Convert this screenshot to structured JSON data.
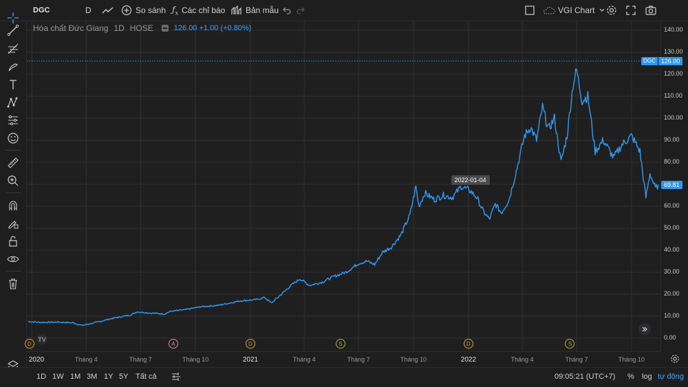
{
  "toolbar": {
    "symbol": "DGC",
    "interval": "D",
    "compare_label": "So sánh",
    "indicators_label": "Các chỉ báo",
    "templates_label": "Bản mẫu",
    "layout_name": "VGI Chart"
  },
  "legend": {
    "name": "Hóa chất Đức Giang",
    "interval": "1D",
    "exchange": "HOSE",
    "last": "126.00",
    "change": "+1.00",
    "change_pct": "(+0.80%)"
  },
  "price_scale": {
    "ticks": [
      "140.00",
      "130.00",
      "120.00",
      "110.00",
      "100.00",
      "90.00",
      "80.00",
      "70.00",
      "60.00",
      "50.00",
      "40.00",
      "30.00",
      "20.00",
      "10.00",
      "0.00"
    ],
    "dgc_tag_label": "DGC",
    "dgc_tag_value": "126.00",
    "last_price_tag": "69.81"
  },
  "time_scale": {
    "labels": [
      {
        "text": "2020",
        "year": true
      },
      {
        "text": "Tháng 4",
        "year": false
      },
      {
        "text": "Tháng 7",
        "year": false
      },
      {
        "text": "Tháng 10",
        "year": false
      },
      {
        "text": "2021",
        "year": true
      },
      {
        "text": "Tháng 4",
        "year": false
      },
      {
        "text": "Tháng 7",
        "year": false
      },
      {
        "text": "Tháng 10",
        "year": false
      },
      {
        "text": "2022",
        "year": true
      },
      {
        "text": "Tháng 4",
        "year": false
      },
      {
        "text": "Tháng 7",
        "year": false
      },
      {
        "text": "Tháng 10",
        "year": false
      }
    ]
  },
  "crosshair_date": "2022-01-04",
  "events": [
    {
      "letter": "D",
      "color": "#e0a020"
    },
    {
      "letter": "A",
      "color": "#e88aa0"
    },
    {
      "letter": "D",
      "color": "#e0a020"
    },
    {
      "letter": "S",
      "color": "#b0b020"
    },
    {
      "letter": "D",
      "color": "#e0a020"
    },
    {
      "letter": "S",
      "color": "#b0b020"
    }
  ],
  "bottom": {
    "ranges": [
      "1D",
      "1W",
      "1M",
      "3M",
      "1Y",
      "5Y",
      "Tất cả"
    ],
    "time": "09:05:21 (UTC+7)",
    "pct": "%",
    "log": "log",
    "auto": "tự động"
  },
  "colors": {
    "line": "#2f96ec",
    "accent": "#3ea6ff",
    "background": "#1f1f20",
    "grid": "#313133"
  },
  "chart_data": {
    "type": "line",
    "title": "",
    "ylabel": "",
    "xlabel": "",
    "ylim": [
      0,
      140
    ],
    "x_start": "2019-12-26",
    "x_end": "2022-11-15",
    "series": [
      {
        "values_by_date": [
          [
            "2019-12-26",
            7.6
          ],
          [
            "2020-01-15",
            7.2
          ],
          [
            "2020-02-15",
            7.3
          ],
          [
            "2020-03-10",
            7.0
          ],
          [
            "2020-03-25",
            5.8
          ],
          [
            "2020-04-15",
            7.0
          ],
          [
            "2020-05-15",
            9.0
          ],
          [
            "2020-06-15",
            10.6
          ],
          [
            "2020-06-25",
            12.0
          ],
          [
            "2020-07-15",
            11.5
          ],
          [
            "2020-08-10",
            11.0
          ],
          [
            "2020-08-20",
            12.2
          ],
          [
            "2020-09-15",
            13.0
          ],
          [
            "2020-10-10",
            14.3
          ],
          [
            "2020-11-10",
            15.0
          ],
          [
            "2020-12-15",
            17.0
          ],
          [
            "2021-01-10",
            17.5
          ],
          [
            "2021-01-25",
            18.5
          ],
          [
            "2021-02-05",
            16.0
          ],
          [
            "2021-02-20",
            19.5
          ],
          [
            "2021-03-10",
            24.0
          ],
          [
            "2021-03-25",
            27.0
          ],
          [
            "2021-04-10",
            24.0
          ],
          [
            "2021-05-01",
            25.5
          ],
          [
            "2021-05-20",
            28.0
          ],
          [
            "2021-06-10",
            30.0
          ],
          [
            "2021-07-01",
            34.0
          ],
          [
            "2021-07-15",
            35.0
          ],
          [
            "2021-07-28",
            33.5
          ],
          [
            "2021-08-10",
            39.0
          ],
          [
            "2021-08-25",
            41.5
          ],
          [
            "2021-09-10",
            47.0
          ],
          [
            "2021-09-25",
            56.0
          ],
          [
            "2021-10-05",
            69.0
          ],
          [
            "2021-10-10",
            60.0
          ],
          [
            "2021-10-20",
            66.0
          ],
          [
            "2021-11-05",
            63.0
          ],
          [
            "2021-11-20",
            65.0
          ],
          [
            "2021-12-05",
            64.0
          ],
          [
            "2021-12-20",
            69.0
          ],
          [
            "2022-01-04",
            67.0
          ],
          [
            "2022-01-15",
            64.0
          ],
          [
            "2022-01-25",
            58.0
          ],
          [
            "2022-02-05",
            54.0
          ],
          [
            "2022-02-15",
            61.0
          ],
          [
            "2022-02-25",
            57.0
          ],
          [
            "2022-03-10",
            63.0
          ],
          [
            "2022-03-22",
            76.0
          ],
          [
            "2022-04-05",
            92.0
          ],
          [
            "2022-04-15",
            96.0
          ],
          [
            "2022-04-25",
            90.0
          ],
          [
            "2022-05-05",
            105.0
          ],
          [
            "2022-05-15",
            95.0
          ],
          [
            "2022-05-25",
            100.0
          ],
          [
            "2022-06-05",
            80.0
          ],
          [
            "2022-06-15",
            92.0
          ],
          [
            "2022-06-25",
            115.0
          ],
          [
            "2022-07-01",
            122.0
          ],
          [
            "2022-07-10",
            108.0
          ],
          [
            "2022-07-20",
            110.0
          ],
          [
            "2022-08-01",
            85.0
          ],
          [
            "2022-08-15",
            90.0
          ],
          [
            "2022-09-01",
            82.0
          ],
          [
            "2022-09-15",
            88.0
          ],
          [
            "2022-10-01",
            92.0
          ],
          [
            "2022-10-15",
            85.0
          ],
          [
            "2022-10-25",
            64.0
          ],
          [
            "2022-11-01",
            75.0
          ],
          [
            "2022-11-10",
            68.0
          ],
          [
            "2022-11-15",
            69.81
          ]
        ]
      }
    ]
  }
}
